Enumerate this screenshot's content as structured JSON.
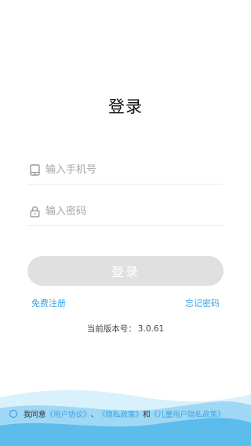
{
  "header": {
    "title": "登录"
  },
  "form": {
    "phone_placeholder": "输入手机号",
    "password_placeholder": "输入密码",
    "phone_value": "",
    "password_value": "",
    "login_label": "登录"
  },
  "links": {
    "register": "免费注册",
    "forgot": "忘记密码"
  },
  "version": {
    "label": "当前版本号：",
    "number": "3.0.61"
  },
  "agreement": {
    "prefix": "我同意",
    "user_agreement": "《用户协议》",
    "sep": "、",
    "privacy_policy": "《隐私政策》",
    "and": "和",
    "children_privacy": "《儿童用户隐私政策》"
  },
  "colors": {
    "accent": "#3aa2e6",
    "button_disabled": "#e0e0e0",
    "wave_light": "#d7f0fb",
    "wave_dark": "#4fb7ea"
  }
}
